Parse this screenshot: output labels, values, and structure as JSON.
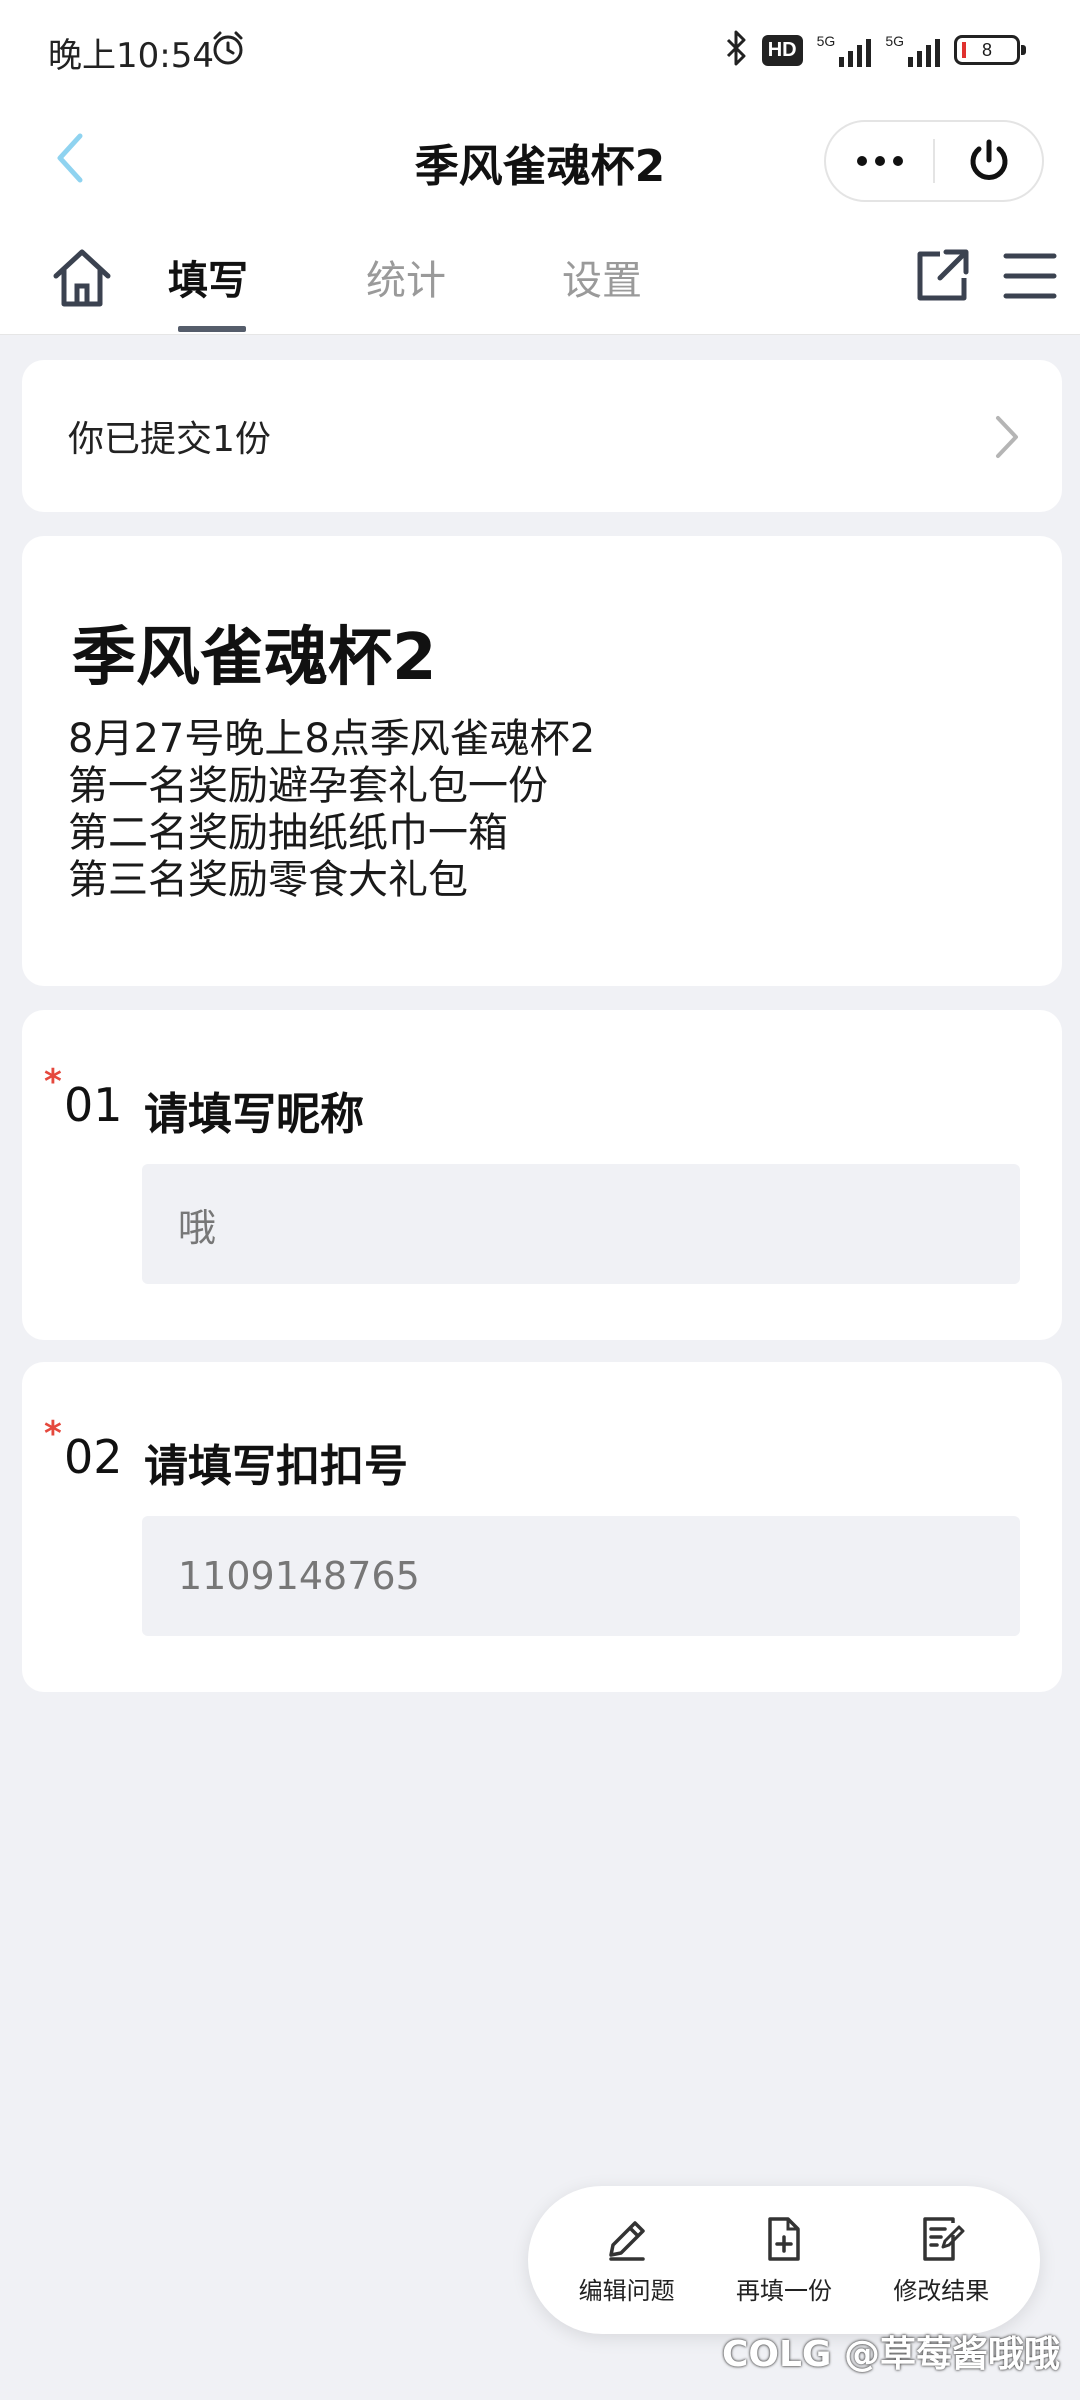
{
  "status_bar": {
    "time": "晚上10:54",
    "hd": "HD",
    "signal_label_1": "5G",
    "signal_label_2": "5G",
    "battery": "8"
  },
  "navbar": {
    "title": "季风雀魂杯2",
    "icons": {
      "back": "chevron-left-icon",
      "more": "more-dots-icon",
      "power": "power-icon"
    }
  },
  "tabs": {
    "items": [
      {
        "label": "填写",
        "active": true
      },
      {
        "label": "统计",
        "active": false
      },
      {
        "label": "设置",
        "active": false
      }
    ],
    "icons": {
      "home": "home-icon",
      "share": "share-icon",
      "menu": "menu-icon"
    }
  },
  "submitted": {
    "text": "你已提交1份"
  },
  "intro": {
    "title": "季风雀魂杯2",
    "lines": [
      "8月27号晚上8点季风雀魂杯2",
      "第一名奖励避孕套礼包一份",
      "第二名奖励抽纸纸巾一箱",
      "第三名奖励零食大礼包"
    ]
  },
  "questions": [
    {
      "required_mark": "*",
      "number": "01",
      "title": "请填写昵称",
      "value": "哦"
    },
    {
      "required_mark": "*",
      "number": "02",
      "title": "请填写扣扣号",
      "value": "1109148765"
    }
  ],
  "actions": [
    {
      "label": "编辑问题",
      "icon": "pencil-icon"
    },
    {
      "label": "再填一份",
      "icon": "file-plus-icon"
    },
    {
      "label": "修改结果",
      "icon": "edit-doc-icon"
    }
  ],
  "watermark": "COLG @草莓酱哦哦",
  "colors": {
    "accent": "#555d6b",
    "required": "#e5483d",
    "back_arrow": "#8fd3f0"
  }
}
